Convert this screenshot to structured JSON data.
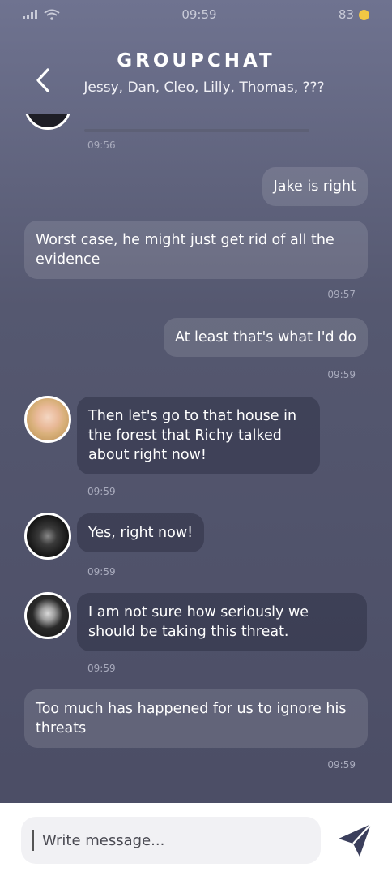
{
  "status_bar": {
    "time": "09:59",
    "battery": "83"
  },
  "header": {
    "title": "GROUPCHAT",
    "members": "Jessy, Dan, Cleo, Lilly, Thomas, ???"
  },
  "messages": [
    {
      "text": "",
      "time": "09:56",
      "direction": "incoming"
    },
    {
      "text": "Jake is right",
      "time": "",
      "direction": "outgoing"
    },
    {
      "text": "Worst case, he might just get rid of all the evidence",
      "time": "09:57",
      "direction": "outgoing"
    },
    {
      "text": "At least that's what I'd do",
      "time": "09:59",
      "direction": "outgoing"
    },
    {
      "text": "Then let's go to that house in the forest that Richy talked about right now!",
      "time": "09:59",
      "direction": "incoming"
    },
    {
      "text": "Yes, right now!",
      "time": "09:59",
      "direction": "incoming"
    },
    {
      "text": "I am not sure how seriously we should be taking this threat.",
      "time": "09:59",
      "direction": "incoming"
    },
    {
      "text": "Too much has happened for us to ignore his threats",
      "time": "09:59",
      "direction": "outgoing"
    }
  ],
  "composer": {
    "placeholder": "Write message..."
  },
  "colors": {
    "accent": "#3b3f5c",
    "battery": "#f2c744"
  }
}
